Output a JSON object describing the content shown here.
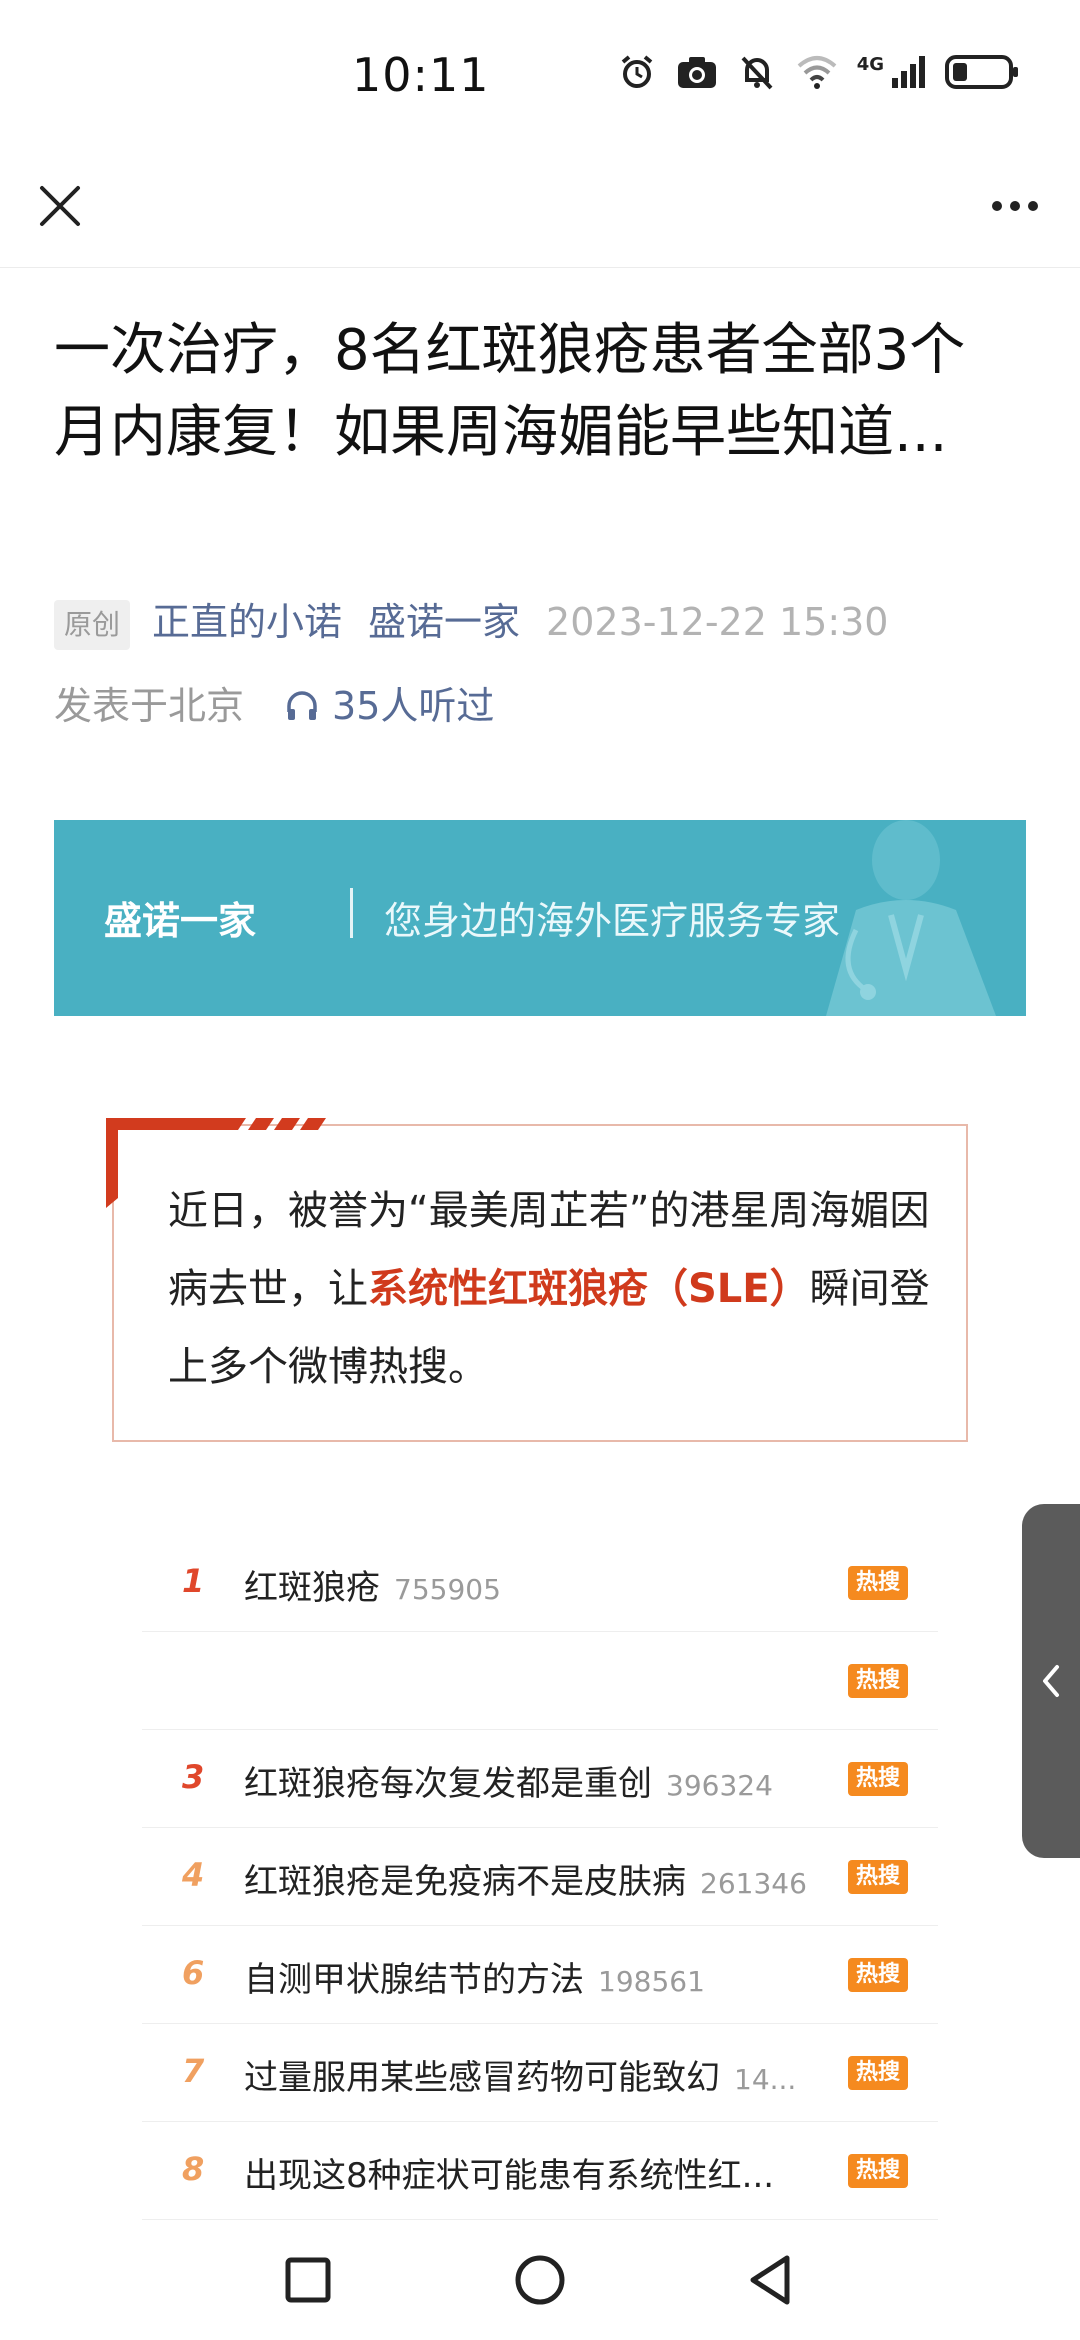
{
  "status_bar": {
    "time": "10:11",
    "network": "4G",
    "icons": [
      "alarm-icon",
      "camera-icon",
      "mute-icon",
      "wifi-icon",
      "signal-icon",
      "battery-icon"
    ]
  },
  "topbar": {
    "close_icon": "close-icon",
    "more_icon": "more-icon"
  },
  "article": {
    "title": "一次治疗，8名红斑狼疮患者全部3个月内康复！如果周海媚能早些知道...",
    "badge": "原创",
    "author": "正直的小诺",
    "account": "盛诺一家",
    "date": "2023-12-22 15:30",
    "location": "发表于北京",
    "listens": "35人听过"
  },
  "banner": {
    "brand": "盛诺一家",
    "slogan": "您身边的海外医疗服务专家",
    "color": "#49b0c2"
  },
  "quote": {
    "part1": "近日，被誉为“最美周芷若”的港星周海媚因病去世，让",
    "highlight": "系统性红斑狼疮（SLE）",
    "part2": "瞬间登上多个微博热搜。",
    "highlight_color": "#d03a1c"
  },
  "hot_list": [
    {
      "rank": "1",
      "keyword": "红斑狼疮",
      "count": "755905",
      "tag": "热搜"
    },
    {
      "rank": "",
      "keyword": "",
      "count": "",
      "tag": "热搜"
    },
    {
      "rank": "3",
      "keyword": "红斑狼疮每次复发都是重创",
      "count": "396324",
      "tag": "热搜"
    },
    {
      "rank": "4",
      "keyword": "红斑狼疮是免疫病不是皮肤病",
      "count": "261346",
      "tag": "热搜"
    },
    {
      "rank": "6",
      "keyword": "自测甲状腺结节的方法",
      "count": "198561",
      "tag": "热搜"
    },
    {
      "rank": "7",
      "keyword": "过量服用某些感冒药物可能致幻",
      "count": "14...",
      "tag": "热搜"
    },
    {
      "rank": "8",
      "keyword": "出现这8种症状可能患有系统性红...",
      "count": "",
      "tag": "热搜"
    }
  ],
  "side_handle_icon": "chevron-left-icon",
  "navbar": {
    "icons": [
      "recents-icon",
      "home-icon",
      "back-icon"
    ]
  }
}
